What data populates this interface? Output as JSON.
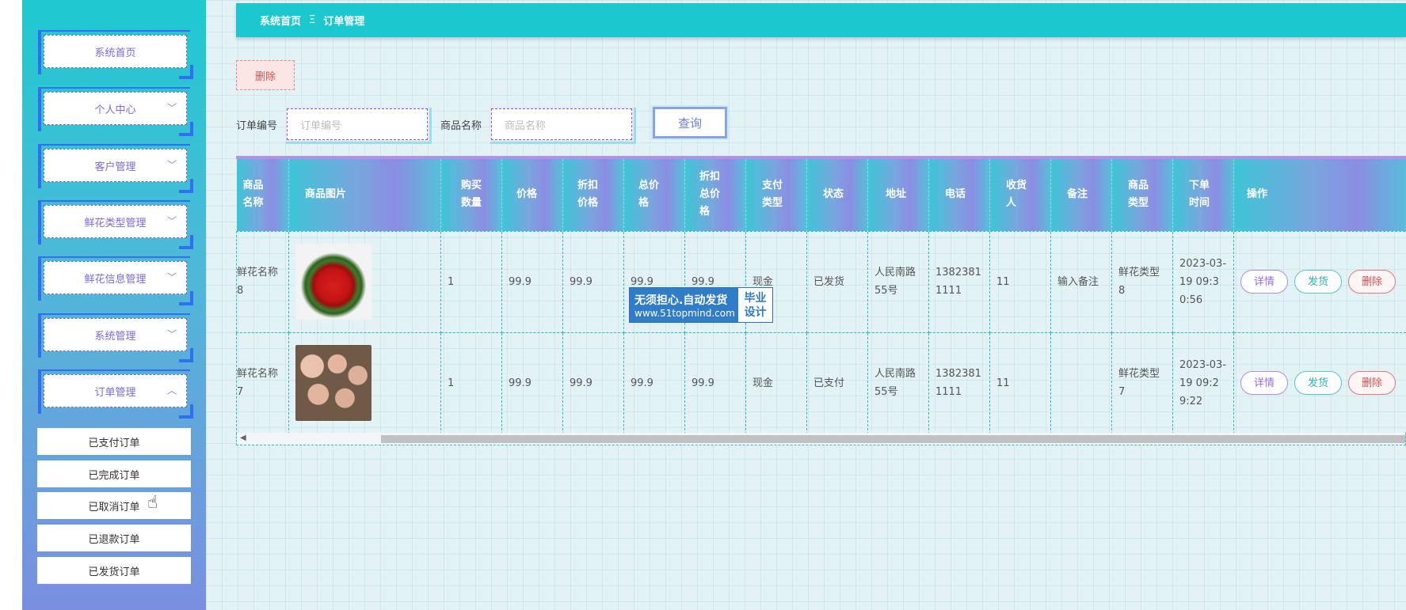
{
  "sidebar": {
    "menu": [
      {
        "label": "系统首页",
        "has_chevron": false
      },
      {
        "label": "个人中心",
        "has_chevron": true
      },
      {
        "label": "客户管理",
        "has_chevron": true
      },
      {
        "label": "鲜花类型管理",
        "has_chevron": true
      },
      {
        "label": "鲜花信息管理",
        "has_chevron": true
      },
      {
        "label": "系统管理",
        "has_chevron": true
      },
      {
        "label": "订单管理",
        "has_chevron": true,
        "expanded": true
      }
    ],
    "submenu": [
      "已支付订单",
      "已完成订单",
      "已取消订单",
      "已退款订单",
      "已发货订单"
    ]
  },
  "breadcrumb": {
    "home": "系统首页",
    "separator": "Ξ",
    "current": "订单管理"
  },
  "toolbar": {
    "delete_label": "删除"
  },
  "search": {
    "order_no_label": "订单编号",
    "order_no_placeholder": "订单编号",
    "product_label": "商品名称",
    "product_placeholder": "商品名称",
    "query_label": "查询"
  },
  "table": {
    "headers": [
      "商品\n名称",
      "商品图片",
      "购买\n数量",
      "价格",
      "折扣\n价格",
      "总价\n格",
      "折扣\n总价\n格",
      "支付\n类型",
      "状态",
      "地址",
      "电话",
      "收货\n人",
      "备注",
      "商品\n类型",
      "下单\n时间",
      "操作"
    ],
    "rows": [
      {
        "name": "鲜花名称8",
        "image": "red-roses-bouquet",
        "qty": "1",
        "price": "99.9",
        "discount_price": "99.9",
        "total": "99.9",
        "discount_total": "99.9",
        "pay_type": "现金",
        "status": "已发货",
        "address": "人民南路55号",
        "phone": "13823811111",
        "receiver": "11",
        "remark": "输入备注",
        "type": "鲜花类型8",
        "time": "2023-03-19 09:30:56"
      },
      {
        "name": "鲜花名称7",
        "image": "champagne-roses-bouquet",
        "qty": "1",
        "price": "99.9",
        "discount_price": "99.9",
        "total": "99.9",
        "discount_total": "99.9",
        "pay_type": "现金",
        "status": "已支付",
        "address": "人民南路55号",
        "phone": "13823811111",
        "receiver": "11",
        "remark": "",
        "type": "鲜花类型7",
        "time": "2023-03-19 09:29:22"
      }
    ],
    "actions": {
      "detail": "详情",
      "ship": "发货",
      "delete": "删除"
    }
  },
  "watermark": {
    "line1": "无须担心.自动发货",
    "line2": "www.51topmind.com",
    "right1": "毕业",
    "right2": "设计"
  }
}
